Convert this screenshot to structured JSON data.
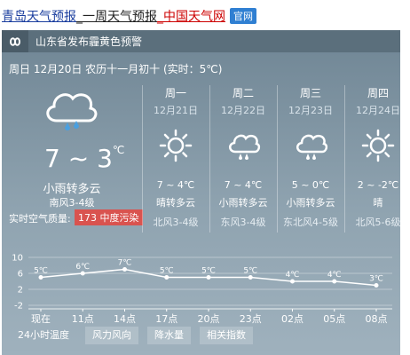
{
  "header": {
    "seg1": "青岛天气预报",
    "seg2": "_一周天气预报",
    "seg3": "_中国天气网",
    "badge": "官网"
  },
  "alert": {
    "text": "山东省发布霾黄色预警",
    "icon": "infinity-icon"
  },
  "today": {
    "line": "周日 12月20日 农历十一月初十 (实时：5℃)",
    "temp": "7 ~ 3",
    "temp_unit": "℃",
    "desc": "小雨转多云",
    "wind": "南风3-4级",
    "aqi_label": "实时空气质量:",
    "aqi_value": "173 中度污染",
    "icon": "rain-cloud-icon"
  },
  "days": [
    {
      "name": "周一",
      "date": "12月21日",
      "temp": "7 ~ 4℃",
      "desc": "晴转多云",
      "wind": "北风3-4级",
      "icon": "sun-icon"
    },
    {
      "name": "周二",
      "date": "12月22日",
      "temp": "7 ~ 4℃",
      "desc": "小雨转多云",
      "wind": "东风3-4级",
      "icon": "rain-cloud-icon"
    },
    {
      "name": "周三",
      "date": "12月23日",
      "temp": "5 ~ 0℃",
      "desc": "小雨转多云",
      "wind": "东北风4-5级",
      "icon": "rain-cloud-icon"
    },
    {
      "name": "周四",
      "date": "12月24日",
      "temp": "2 ~ -2℃",
      "desc": "晴",
      "wind": "北风5-6级",
      "icon": "sun-icon"
    }
  ],
  "chart_data": {
    "type": "line",
    "categories": [
      "现在",
      "11点",
      "14点",
      "17点",
      "20点",
      "23点",
      "02点",
      "05点",
      "08点"
    ],
    "values": [
      5,
      6,
      7,
      5,
      5,
      5,
      4,
      4,
      3
    ],
    "value_labels": [
      "5℃",
      "6℃",
      "7℃",
      "5℃",
      "5℃",
      "5℃",
      "4℃",
      "4℃",
      "3℃"
    ],
    "y_ticks": [
      "10",
      "6",
      "2",
      "-2"
    ],
    "ylim": [
      -2,
      10
    ],
    "grid": true,
    "line_color": "#ffffff"
  },
  "tabs": [
    "24小时温度",
    "风力风向",
    "降水量",
    "相关指数"
  ]
}
